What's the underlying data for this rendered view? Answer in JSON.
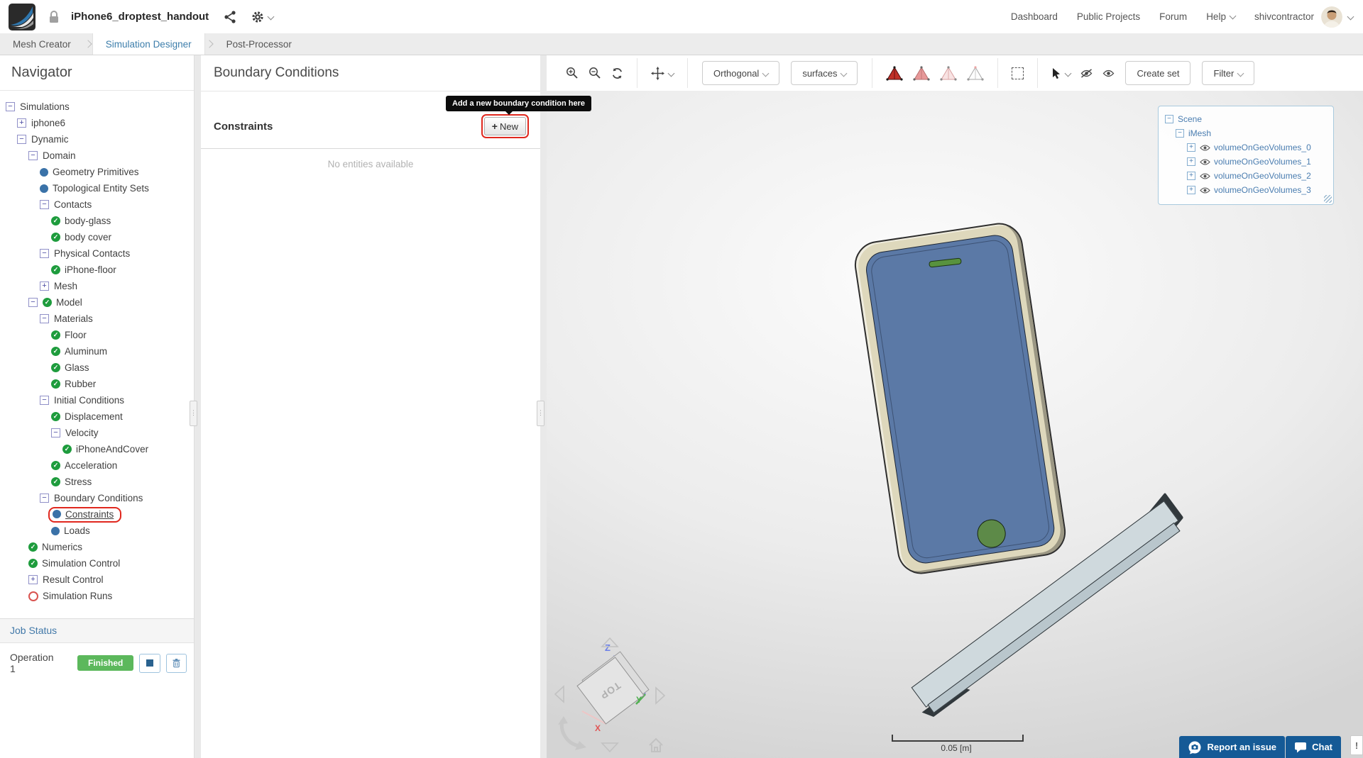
{
  "header": {
    "project_title": "iPhone6_droptest_handout",
    "nav": [
      {
        "label": "Dashboard"
      },
      {
        "label": "Public Projects"
      },
      {
        "label": "Forum"
      },
      {
        "label": "Help",
        "caret": true
      }
    ],
    "username": "shivcontractor"
  },
  "tabs": [
    {
      "label": "Mesh Creator",
      "active": false
    },
    {
      "label": "Simulation Designer",
      "active": true
    },
    {
      "label": "Post-Processor",
      "active": false
    }
  ],
  "navigator": {
    "title": "Navigator",
    "tree": [
      {
        "label": "Simulations",
        "level": 0,
        "expander": "minus"
      },
      {
        "label": "iphone6",
        "level": 1,
        "expander": "plus"
      },
      {
        "label": "Dynamic",
        "level": 1,
        "expander": "minus"
      },
      {
        "label": "Domain",
        "level": 2,
        "expander": "minus"
      },
      {
        "label": "Geometry Primitives",
        "level": 3,
        "icon": "dot"
      },
      {
        "label": "Topological Entity Sets",
        "level": 3,
        "icon": "dot"
      },
      {
        "label": "Contacts",
        "level": 3,
        "expander": "minus"
      },
      {
        "label": "body-glass",
        "level": 4,
        "icon": "check"
      },
      {
        "label": "body cover",
        "level": 4,
        "icon": "check"
      },
      {
        "label": "Physical Contacts",
        "level": 3,
        "expander": "minus"
      },
      {
        "label": "iPhone-floor",
        "level": 4,
        "icon": "check"
      },
      {
        "label": "Mesh",
        "level": 3,
        "expander": "plus"
      },
      {
        "label": "Model",
        "level": 2,
        "expander": "minus",
        "icon": "check"
      },
      {
        "label": "Materials",
        "level": 3,
        "expander": "minus"
      },
      {
        "label": "Floor",
        "level": 4,
        "icon": "check"
      },
      {
        "label": "Aluminum",
        "level": 4,
        "icon": "check"
      },
      {
        "label": "Glass",
        "level": 4,
        "icon": "check"
      },
      {
        "label": "Rubber",
        "level": 4,
        "icon": "check"
      },
      {
        "label": "Initial Conditions",
        "level": 3,
        "expander": "minus"
      },
      {
        "label": "Displacement",
        "level": 4,
        "icon": "check"
      },
      {
        "label": "Velocity",
        "level": 4,
        "expander": "minus"
      },
      {
        "label": "iPhoneAndCover",
        "level": 5,
        "icon": "check"
      },
      {
        "label": "Acceleration",
        "level": 4,
        "icon": "check"
      },
      {
        "label": "Stress",
        "level": 4,
        "icon": "check"
      },
      {
        "label": "Boundary Conditions",
        "level": 3,
        "expander": "minus"
      },
      {
        "label": "Constraints",
        "level": 4,
        "icon": "dot",
        "annotated": true,
        "underline": true
      },
      {
        "label": "Loads",
        "level": 4,
        "icon": "dot"
      },
      {
        "label": "Numerics",
        "level": 2,
        "icon": "check"
      },
      {
        "label": "Simulation Control",
        "level": 2,
        "icon": "check"
      },
      {
        "label": "Result Control",
        "level": 2,
        "expander": "plus"
      },
      {
        "label": "Simulation Runs",
        "level": 2,
        "icon": "circle"
      }
    ],
    "job_status": {
      "title": "Job Status",
      "operation": "Operation 1",
      "status": "Finished"
    }
  },
  "panel": {
    "title": "Boundary Conditions",
    "section": "Constraints",
    "new_button_label": "New",
    "tooltip": "Add a new boundary condition here",
    "empty_text": "No entities available"
  },
  "viewport": {
    "toolbar": {
      "projection": "Orthogonal",
      "render_mode": "surfaces",
      "create_set": "Create set",
      "filter": "Filter",
      "icon_buttons": [
        "zoom-in",
        "zoom-out",
        "refresh",
        "pan",
        "mesh-quality-100",
        "mesh-quality-75",
        "mesh-quality-50",
        "mesh-quality-25",
        "box-select",
        "cursor-select",
        "hide-entities",
        "show-entities"
      ]
    },
    "scene_tree": {
      "root": "Scene",
      "mesh": "iMesh",
      "volumes": [
        "volumeOnGeoVolumes_0",
        "volumeOnGeoVolumes_1",
        "volumeOnGeoVolumes_2",
        "volumeOnGeoVolumes_3"
      ]
    },
    "cube_label": "TOP",
    "axis_labels": {
      "x": "X",
      "y": "Y",
      "z": "Z"
    },
    "scale_label": "0.05 [m]",
    "report_button": "Report an issue",
    "chat_button": "Chat",
    "alert_button": "!"
  },
  "icons": {
    "lock-icon": "padlock",
    "share-icon": "share-nodes",
    "settings-gear-icon": "gear",
    "zoom-in-icon": "magnifier-plus",
    "zoom-out-icon": "magnifier-minus",
    "refresh-icon": "circular-arrow",
    "pan-icon": "move-cross-arrows",
    "box-select-icon": "dashed-rectangle",
    "cursor-icon": "pointer-arrow",
    "hide-icon": "eye-slash",
    "show-icon": "eye",
    "stop-icon": "filled-square",
    "delete-icon": "trash-can",
    "report-icon": "camera-bubble",
    "chat-icon": "speech-bubble",
    "home-icon": "house-outline",
    "rotate-icon": "curved-arrow"
  },
  "colors": {
    "accent_blue": "#3d7eab",
    "annotation_red": "#e0281e",
    "badge_green": "#5cb85c",
    "button_blue": "#155a96",
    "scene_link_blue": "#4a7db0",
    "tree_dot_blue": "#3a72a8",
    "tree_check_green": "#1e9c3d",
    "run_circle_red": "#d9534f",
    "phone_body": "#ded8bc",
    "phone_screen": "#5b79a6",
    "phone_home_green": "#5d8a48",
    "floor_top": "#cfd9dd",
    "floor_dark": "#31383c",
    "axis_x": "#e05555",
    "axis_y": "#4db04d",
    "axis_z": "#6b7fe8"
  }
}
